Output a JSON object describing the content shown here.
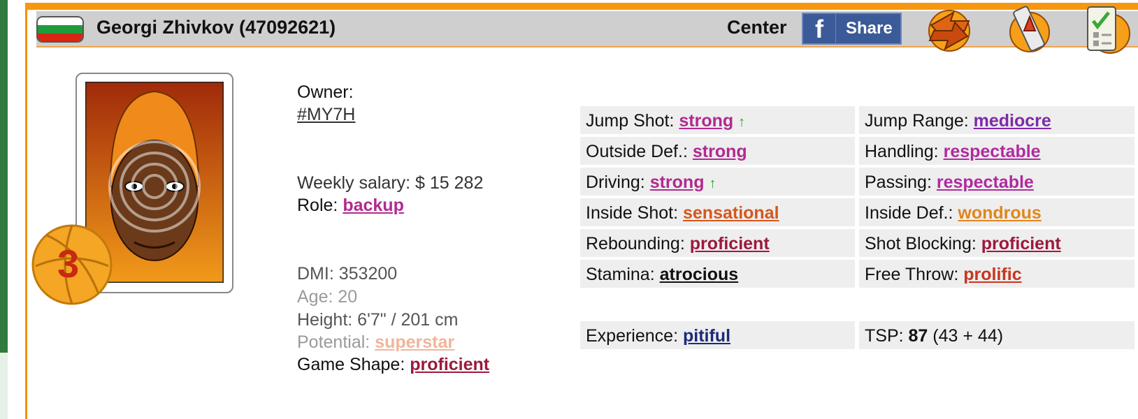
{
  "header": {
    "player_name": "Georgi Zhivkov (47092621)",
    "position": "Center",
    "share_f": "f",
    "share_label": "Share"
  },
  "avatar": {
    "level": "3"
  },
  "info": {
    "owner_label": "Owner:",
    "owner_value": "#MY7H",
    "salary_label": "Weekly salary:",
    "salary_value": "$ 15 282",
    "role_label": "Role:",
    "role_value": "backup",
    "dmi_label": "DMI:",
    "dmi_value": "353200",
    "age_label": "Age:",
    "age_value": "20",
    "height_label": "Height:",
    "height_value": "6'7\" / 201 cm",
    "potential_label": "Potential:",
    "potential_value": "superstar",
    "shape_label": "Game Shape:",
    "shape_value": "proficient"
  },
  "skills": [
    {
      "label": "Jump Shot:",
      "value": "strong",
      "color": "#b02a8f",
      "arrow": "↑"
    },
    {
      "label": "Jump Range:",
      "value": "mediocre",
      "color": "#7d2aa8",
      "arrow": ""
    },
    {
      "label": "Outside Def.:",
      "value": "strong",
      "color": "#b02a8f",
      "arrow": ""
    },
    {
      "label": "Handling:",
      "value": "respectable",
      "color": "#b02aa0",
      "arrow": ""
    },
    {
      "label": "Driving:",
      "value": "strong",
      "color": "#b02a8f",
      "arrow": "↑"
    },
    {
      "label": "Passing:",
      "value": "respectable",
      "color": "#b02aa0",
      "arrow": ""
    },
    {
      "label": "Inside Shot:",
      "value": "sensational",
      "color": "#d4571c",
      "arrow": ""
    },
    {
      "label": "Inside Def.:",
      "value": "wondrous",
      "color": "#e0861e",
      "arrow": ""
    },
    {
      "label": "Rebounding:",
      "value": "proficient",
      "color": "#9a1a3c",
      "arrow": ""
    },
    {
      "label": "Shot Blocking:",
      "value": "proficient",
      "color": "#9a1a3c",
      "arrow": ""
    },
    {
      "label": "Stamina:",
      "value": "atrocious",
      "color": "#111111",
      "arrow": ""
    },
    {
      "label": "Free Throw:",
      "value": "prolific",
      "color": "#c7361e",
      "arrow": ""
    }
  ],
  "experience": {
    "label": "Experience:",
    "value": "pitiful",
    "color": "#1c2a78"
  },
  "tsp": {
    "label": "TSP:",
    "total": "87",
    "breakdown": "(43 + 44)"
  },
  "colors": {
    "accent_orange": "#f7960f",
    "header_gray": "#cfcfcf",
    "facebook_blue": "#3b5a98"
  }
}
